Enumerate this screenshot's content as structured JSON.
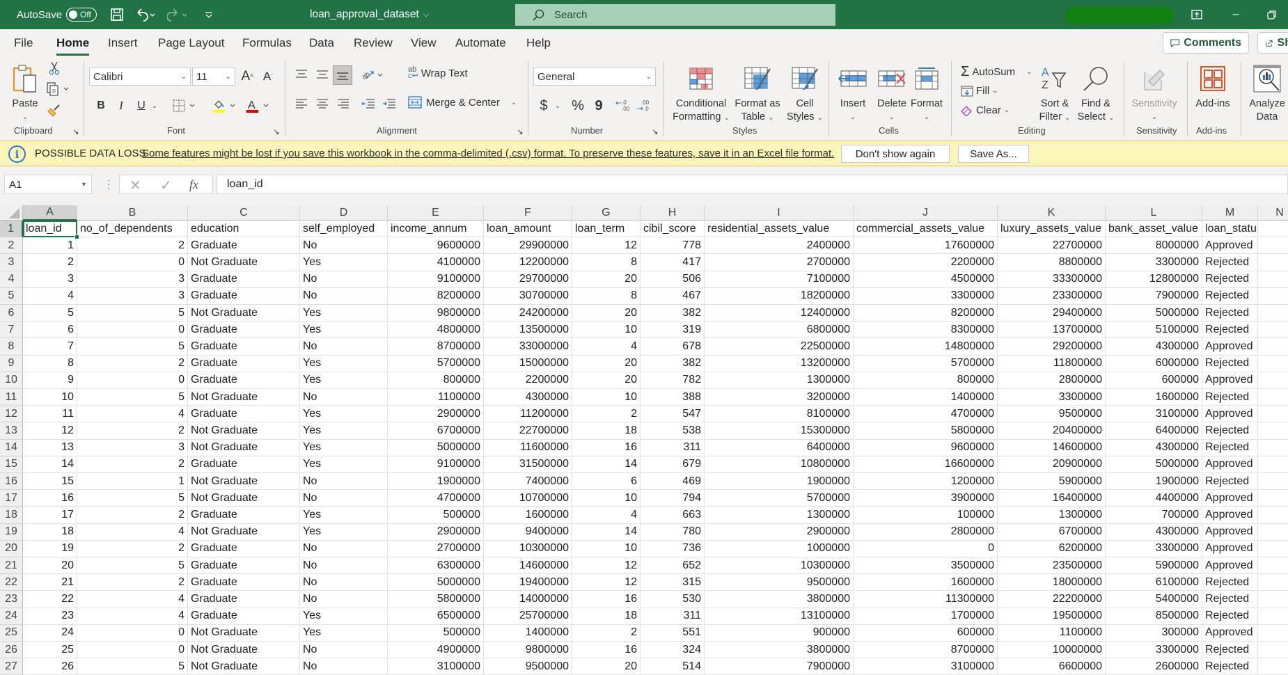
{
  "titlebar": {
    "autosave_label": "AutoSave",
    "autosave_state": "Off",
    "document_title": "loan_approval_dataset",
    "search_placeholder": "Search"
  },
  "menu": {
    "tabs": [
      "File",
      "Home",
      "Insert",
      "Page Layout",
      "Formulas",
      "Data",
      "Review",
      "View",
      "Automate",
      "Help"
    ],
    "active_tab": "Home",
    "comments_label": "Comments",
    "share_label": "Sh"
  },
  "ribbon": {
    "clipboard": {
      "paste": "Paste",
      "group": "Clipboard"
    },
    "font": {
      "name": "Calibri",
      "size": "11",
      "group": "Font",
      "bold": "B",
      "italic": "I",
      "underline": "U"
    },
    "alignment": {
      "wrap_text": "Wrap Text",
      "merge_center": "Merge & Center",
      "group": "Alignment"
    },
    "number": {
      "format": "General",
      "currency": "$",
      "percent": "%",
      "comma": "9",
      "group": "Number"
    },
    "styles": {
      "conditional_1": "Conditional",
      "conditional_2": "Formatting",
      "format_table_1": "Format as",
      "format_table_2": "Table",
      "cell_styles_1": "Cell",
      "cell_styles_2": "Styles",
      "group": "Styles"
    },
    "cells": {
      "insert": "Insert",
      "delete": "Delete",
      "format": "Format",
      "group": "Cells"
    },
    "editing": {
      "autosum": "AutoSum",
      "fill": "Fill",
      "clear": "Clear",
      "sort_1": "Sort &",
      "sort_2": "Filter",
      "find_1": "Find &",
      "find_2": "Select",
      "group": "Editing"
    },
    "sensitivity": {
      "label": "Sensitivity",
      "group": "Sensitivity"
    },
    "addins": {
      "label": "Add-ins",
      "group": "Add-ins"
    },
    "analyze": {
      "label_1": "Analyze",
      "label_2": "Data"
    }
  },
  "infobar": {
    "title": "POSSIBLE DATA LOSS",
    "message": "Some features might be lost if you save this workbook in the comma-delimited (.csv) format. To preserve these features, save it in an Excel file format.",
    "dont_show": "Don't show again",
    "save_as": "Save As..."
  },
  "formula_bar": {
    "name_box": "A1",
    "formula": "loan_id",
    "fx": "fx"
  },
  "sheet": {
    "active_cell": "A1",
    "columns": [
      "A",
      "B",
      "C",
      "D",
      "E",
      "F",
      "G",
      "H",
      "I",
      "J",
      "K",
      "L",
      "M",
      "N"
    ],
    "headers": [
      "loan_id",
      "no_of_dependents",
      "education",
      "self_employed",
      "income_annum",
      "loan_amount",
      "loan_term",
      "cibil_score",
      "residential_assets_value",
      "commercial_assets_value",
      "luxury_assets_value",
      "bank_asset_value",
      "loan_status"
    ],
    "rows": [
      [
        1,
        2,
        "Graduate",
        "No",
        9600000,
        29900000,
        12,
        778,
        2400000,
        17600000,
        22700000,
        8000000,
        "Approved"
      ],
      [
        2,
        0,
        "Not Graduate",
        "Yes",
        4100000,
        12200000,
        8,
        417,
        2700000,
        2200000,
        8800000,
        3300000,
        "Rejected"
      ],
      [
        3,
        3,
        "Graduate",
        "No",
        9100000,
        29700000,
        20,
        506,
        7100000,
        4500000,
        33300000,
        12800000,
        "Rejected"
      ],
      [
        4,
        3,
        "Graduate",
        "No",
        8200000,
        30700000,
        8,
        467,
        18200000,
        3300000,
        23300000,
        7900000,
        "Rejected"
      ],
      [
        5,
        5,
        "Not Graduate",
        "Yes",
        9800000,
        24200000,
        20,
        382,
        12400000,
        8200000,
        29400000,
        5000000,
        "Rejected"
      ],
      [
        6,
        0,
        "Graduate",
        "Yes",
        4800000,
        13500000,
        10,
        319,
        6800000,
        8300000,
        13700000,
        5100000,
        "Rejected"
      ],
      [
        7,
        5,
        "Graduate",
        "No",
        8700000,
        33000000,
        4,
        678,
        22500000,
        14800000,
        29200000,
        4300000,
        "Approved"
      ],
      [
        8,
        2,
        "Graduate",
        "Yes",
        5700000,
        15000000,
        20,
        382,
        13200000,
        5700000,
        11800000,
        6000000,
        "Rejected"
      ],
      [
        9,
        0,
        "Graduate",
        "Yes",
        800000,
        2200000,
        20,
        782,
        1300000,
        800000,
        2800000,
        600000,
        "Approved"
      ],
      [
        10,
        5,
        "Not Graduate",
        "No",
        1100000,
        4300000,
        10,
        388,
        3200000,
        1400000,
        3300000,
        1600000,
        "Rejected"
      ],
      [
        11,
        4,
        "Graduate",
        "Yes",
        2900000,
        11200000,
        2,
        547,
        8100000,
        4700000,
        9500000,
        3100000,
        "Approved"
      ],
      [
        12,
        2,
        "Not Graduate",
        "Yes",
        6700000,
        22700000,
        18,
        538,
        15300000,
        5800000,
        20400000,
        6400000,
        "Rejected"
      ],
      [
        13,
        3,
        "Not Graduate",
        "Yes",
        5000000,
        11600000,
        16,
        311,
        6400000,
        9600000,
        14600000,
        4300000,
        "Rejected"
      ],
      [
        14,
        2,
        "Graduate",
        "Yes",
        9100000,
        31500000,
        14,
        679,
        10800000,
        16600000,
        20900000,
        5000000,
        "Approved"
      ],
      [
        15,
        1,
        "Not Graduate",
        "No",
        1900000,
        7400000,
        6,
        469,
        1900000,
        1200000,
        5900000,
        1900000,
        "Rejected"
      ],
      [
        16,
        5,
        "Not Graduate",
        "No",
        4700000,
        10700000,
        10,
        794,
        5700000,
        3900000,
        16400000,
        4400000,
        "Approved"
      ],
      [
        17,
        2,
        "Graduate",
        "Yes",
        500000,
        1600000,
        4,
        663,
        1300000,
        100000,
        1300000,
        700000,
        "Approved"
      ],
      [
        18,
        4,
        "Not Graduate",
        "Yes",
        2900000,
        9400000,
        14,
        780,
        2900000,
        2800000,
        6700000,
        4300000,
        "Approved"
      ],
      [
        19,
        2,
        "Graduate",
        "No",
        2700000,
        10300000,
        10,
        736,
        1000000,
        0,
        6200000,
        3300000,
        "Approved"
      ],
      [
        20,
        5,
        "Graduate",
        "No",
        6300000,
        14600000,
        12,
        652,
        10300000,
        3500000,
        23500000,
        5900000,
        "Approved"
      ],
      [
        21,
        2,
        "Graduate",
        "No",
        5000000,
        19400000,
        12,
        315,
        9500000,
        1600000,
        18000000,
        6100000,
        "Rejected"
      ],
      [
        22,
        4,
        "Graduate",
        "No",
        5800000,
        14000000,
        16,
        530,
        3800000,
        11300000,
        22200000,
        5400000,
        "Rejected"
      ],
      [
        23,
        4,
        "Graduate",
        "Yes",
        6500000,
        25700000,
        18,
        311,
        13100000,
        1700000,
        19500000,
        8500000,
        "Rejected"
      ],
      [
        24,
        0,
        "Not Graduate",
        "Yes",
        500000,
        1400000,
        2,
        551,
        900000,
        600000,
        1100000,
        300000,
        "Approved"
      ],
      [
        25,
        0,
        "Not Graduate",
        "No",
        4900000,
        9800000,
        16,
        324,
        3800000,
        8700000,
        10000000,
        3300000,
        "Rejected"
      ],
      [
        26,
        5,
        "Not Graduate",
        "No",
        3100000,
        9500000,
        20,
        514,
        7900000,
        3100000,
        6600000,
        2600000,
        "Rejected"
      ]
    ]
  },
  "colors": {
    "excel_green": "#217346",
    "info_bar": "#fcf5b9",
    "ribbon_bg": "#f3f2f1"
  }
}
